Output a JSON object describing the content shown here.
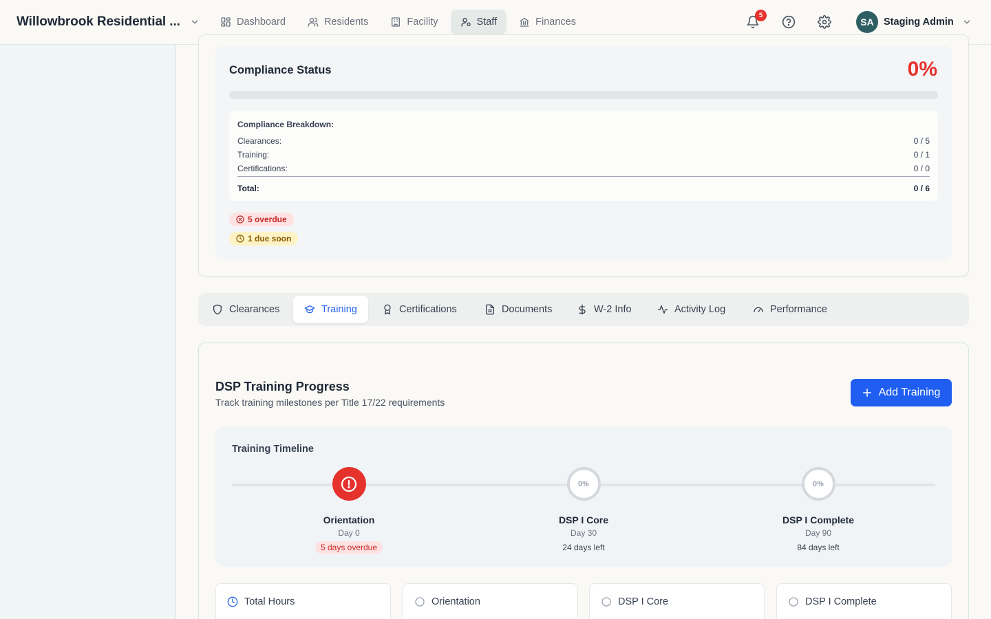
{
  "header": {
    "brand": "Willowbrook Residential ...",
    "nav": [
      {
        "label": "Dashboard",
        "icon": "dashboard-icon"
      },
      {
        "label": "Residents",
        "icon": "users-icon"
      },
      {
        "label": "Facility",
        "icon": "building-icon"
      },
      {
        "label": "Staff",
        "icon": "staff-icon",
        "active": true
      },
      {
        "label": "Finances",
        "icon": "bank-icon"
      }
    ],
    "notifications_count": "5",
    "user_initials": "SA",
    "user_name": "Staging Admin"
  },
  "compliance": {
    "title": "Compliance Status",
    "percent": "0%",
    "progress": 0,
    "breakdown_title": "Compliance Breakdown:",
    "rows": [
      {
        "label": "Clearances:",
        "value": "0 / 5"
      },
      {
        "label": "Training:",
        "value": "0 / 1"
      },
      {
        "label": "Certifications:",
        "value": "0 / 0"
      }
    ],
    "total_label": "Total:",
    "total_value": "0 / 6",
    "overdue": "5 overdue",
    "due_soon": "1 due soon"
  },
  "tabs": [
    {
      "label": "Clearances",
      "icon": "shield-icon"
    },
    {
      "label": "Training",
      "icon": "graduation-cap-icon",
      "active": true
    },
    {
      "label": "Certifications",
      "icon": "award-icon"
    },
    {
      "label": "Documents",
      "icon": "document-icon"
    },
    {
      "label": "W-2 Info",
      "icon": "dollar-icon"
    },
    {
      "label": "Activity Log",
      "icon": "activity-icon"
    },
    {
      "label": "Performance",
      "icon": "gauge-icon"
    }
  ],
  "training": {
    "title": "DSP Training Progress",
    "subtitle": "Track training milestones per Title 17/22 requirements",
    "add_button": "Add Training",
    "timeline_title": "Training Timeline",
    "milestones": [
      {
        "name": "Orientation",
        "day": "Day 0",
        "status": "5 days overdue",
        "state": "overdue"
      },
      {
        "name": "DSP I Core",
        "day": "Day 30",
        "status": "24 days left",
        "state": "pending",
        "percent": "0%"
      },
      {
        "name": "DSP I Complete",
        "day": "Day 90",
        "status": "84 days left",
        "state": "pending",
        "percent": "0%"
      }
    ],
    "stats": [
      {
        "label": "Total Hours",
        "icon": "clock-icon"
      },
      {
        "label": "Orientation",
        "icon": "circle-icon"
      },
      {
        "label": "DSP I Core",
        "icon": "circle-icon"
      },
      {
        "label": "DSP I Complete",
        "icon": "circle-icon"
      }
    ]
  },
  "colors": {
    "accent_blue": "#1f5ef0",
    "danger_red": "#e5322d",
    "avatar_teal": "#2e5e64"
  }
}
